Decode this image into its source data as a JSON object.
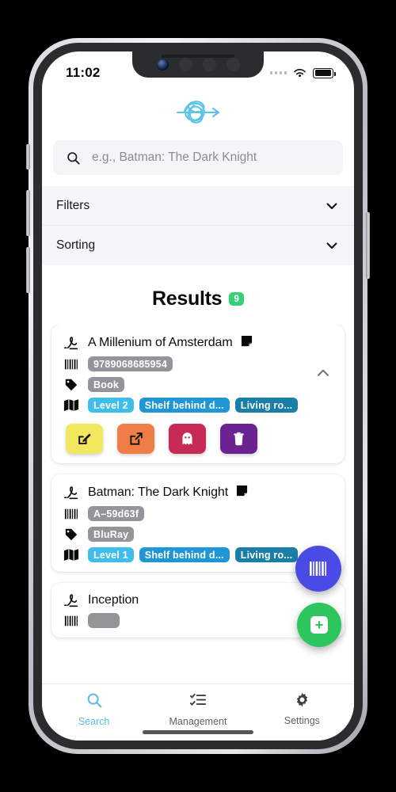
{
  "status_bar": {
    "time": "11:02",
    "cellular_icon": "cellular-dots-icon",
    "wifi_icon": "wifi-icon",
    "battery_icon": "battery-full-icon"
  },
  "app_header": {
    "logo_icon": "scribble-arrow-logo"
  },
  "search": {
    "icon": "search-icon",
    "placeholder": "e.g., Batman: The Dark Knight",
    "value": ""
  },
  "accordions": [
    {
      "label": "Filters",
      "icon": "chevron-down-icon",
      "expanded": false
    },
    {
      "label": "Sorting",
      "icon": "chevron-down-icon",
      "expanded": false
    }
  ],
  "results": {
    "title": "Results",
    "count": "9",
    "badge_color": "#34d176"
  },
  "cards": [
    {
      "title": "A Millenium of Amsterdam",
      "title_icon": "signature-icon",
      "note_icon": "sticky-note-icon",
      "identifier": "9789068685954",
      "identifier_icon": "barcode-icon",
      "type": "Book",
      "type_icon": "tag-icon",
      "location_icon": "map-icon",
      "locations": [
        "Level 2",
        "Shelf behind d...",
        "Living ro..."
      ],
      "expanded": true,
      "collapse_icon": "chevron-up-icon",
      "actions": [
        {
          "name": "edit",
          "icon": "pencil-square-icon",
          "color": "#f3e75f"
        },
        {
          "name": "open-external",
          "icon": "external-link-icon",
          "color": "#ef7d45"
        },
        {
          "name": "ghost",
          "icon": "ghost-icon",
          "color": "#c72a55"
        },
        {
          "name": "delete",
          "icon": "trash-icon",
          "color": "#6b2391"
        }
      ]
    },
    {
      "title": "Batman: The Dark Knight",
      "title_icon": "signature-icon",
      "note_icon": "sticky-note-icon",
      "identifier": "A–59d63f",
      "identifier_icon": "barcode-icon",
      "type": "BluRay",
      "type_icon": "tag-icon",
      "location_icon": "map-icon",
      "locations": [
        "Level 1",
        "Shelf behind d...",
        "Living ro..."
      ],
      "expanded": false
    },
    {
      "title": "Inception",
      "title_icon": "signature-icon",
      "identifier": "",
      "identifier_icon": "barcode-icon",
      "expanded": false
    }
  ],
  "fabs": [
    {
      "name": "scan-barcode",
      "icon": "barcode-icon",
      "color": "#4a4ae4"
    },
    {
      "name": "add-item",
      "icon": "plus-square-icon",
      "color": "#2dc65e",
      "glyph": "+"
    }
  ],
  "tabbar": [
    {
      "label": "Search",
      "icon": "search-icon",
      "active": true
    },
    {
      "label": "Management",
      "icon": "checklist-icon",
      "active": false
    },
    {
      "label": "Settings",
      "icon": "gear-icon",
      "active": false
    }
  ]
}
